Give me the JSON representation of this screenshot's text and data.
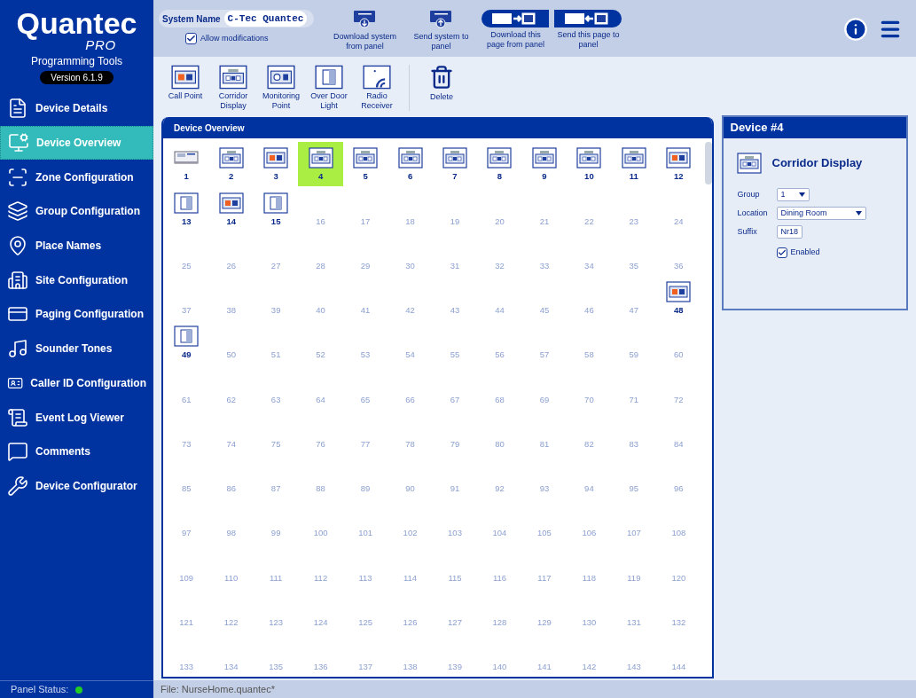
{
  "brand": {
    "name": "Quantec",
    "edition": "PRO",
    "subtitle": "Programming Tools",
    "version": "Version 6.1.9"
  },
  "sidebar": {
    "items": [
      {
        "label": "Device Details",
        "selected": false
      },
      {
        "label": "Device Overview",
        "selected": true
      },
      {
        "label": "Zone Configuration",
        "selected": false
      },
      {
        "label": "Group Configuration",
        "selected": false
      },
      {
        "label": "Place Names",
        "selected": false
      },
      {
        "label": "Site Configuration",
        "selected": false
      },
      {
        "label": "Paging Configuration",
        "selected": false
      },
      {
        "label": "Sounder Tones",
        "selected": false
      },
      {
        "label": "Caller ID Configuration",
        "selected": false
      },
      {
        "label": "Event Log Viewer",
        "selected": false
      },
      {
        "label": "Comments",
        "selected": false
      },
      {
        "label": "Device Configurator",
        "selected": false
      }
    ],
    "panel_status": {
      "label": "Panel Status:",
      "color": "#22cc22"
    }
  },
  "topbar": {
    "system_name": {
      "label": "System Name",
      "value": "C-Tec Quantec"
    },
    "allow_modifications": {
      "label": "Allow modifications",
      "checked": true
    },
    "actions": [
      {
        "label": "Download system from panel",
        "kind": "download"
      },
      {
        "label": "Send system to panel",
        "kind": "send"
      },
      {
        "label": "Download this page from panel",
        "kind": "page-download"
      },
      {
        "label": "Send this page to panel",
        "kind": "page-send"
      }
    ]
  },
  "toolbar": {
    "devices": [
      {
        "label": "Call Point",
        "kind": "callpoint"
      },
      {
        "label": "Corridor Display",
        "kind": "corridor"
      },
      {
        "label": "Monitoring Point",
        "kind": "monitor"
      },
      {
        "label": "Over Door Light",
        "kind": "overdoor"
      },
      {
        "label": "Radio Receiver",
        "kind": "radio"
      }
    ],
    "delete": "Delete"
  },
  "overview": {
    "title": "Device Overview",
    "slots": [
      {
        "number": "1",
        "kind": "panel",
        "selected": false
      },
      {
        "number": "2",
        "kind": "corridor",
        "selected": false
      },
      {
        "number": "3",
        "kind": "callpoint",
        "selected": false
      },
      {
        "number": "4",
        "kind": "corridor",
        "selected": true
      },
      {
        "number": "5",
        "kind": "corridor",
        "selected": false
      },
      {
        "number": "6",
        "kind": "corridor",
        "selected": false
      },
      {
        "number": "7",
        "kind": "corridor",
        "selected": false
      },
      {
        "number": "8",
        "kind": "corridor",
        "selected": false
      },
      {
        "number": "9",
        "kind": "corridor",
        "selected": false
      },
      {
        "number": "10",
        "kind": "corridor",
        "selected": false
      },
      {
        "number": "11",
        "kind": "corridor",
        "selected": false
      },
      {
        "number": "12",
        "kind": "callpoint",
        "selected": false
      },
      {
        "number": "13",
        "kind": "overdoor",
        "selected": false
      },
      {
        "number": "14",
        "kind": "callpoint",
        "selected": false
      },
      {
        "number": "15",
        "kind": "overdoor",
        "selected": false
      },
      {
        "number": "16",
        "kind": "empty",
        "selected": false
      },
      {
        "number": "17",
        "kind": "empty",
        "selected": false
      },
      {
        "number": "18",
        "kind": "empty",
        "selected": false
      },
      {
        "number": "19",
        "kind": "empty",
        "selected": false
      },
      {
        "number": "20",
        "kind": "empty",
        "selected": false
      },
      {
        "number": "21",
        "kind": "empty",
        "selected": false
      },
      {
        "number": "22",
        "kind": "empty",
        "selected": false
      },
      {
        "number": "23",
        "kind": "empty",
        "selected": false
      },
      {
        "number": "24",
        "kind": "empty",
        "selected": false
      },
      {
        "number": "25",
        "kind": "empty",
        "selected": false
      },
      {
        "number": "26",
        "kind": "empty",
        "selected": false
      },
      {
        "number": "27",
        "kind": "empty",
        "selected": false
      },
      {
        "number": "28",
        "kind": "empty",
        "selected": false
      },
      {
        "number": "29",
        "kind": "empty",
        "selected": false
      },
      {
        "number": "30",
        "kind": "empty",
        "selected": false
      },
      {
        "number": "31",
        "kind": "empty",
        "selected": false
      },
      {
        "number": "32",
        "kind": "empty",
        "selected": false
      },
      {
        "number": "33",
        "kind": "empty",
        "selected": false
      },
      {
        "number": "34",
        "kind": "empty",
        "selected": false
      },
      {
        "number": "35",
        "kind": "empty",
        "selected": false
      },
      {
        "number": "36",
        "kind": "empty",
        "selected": false
      },
      {
        "number": "37",
        "kind": "empty",
        "selected": false
      },
      {
        "number": "38",
        "kind": "empty",
        "selected": false
      },
      {
        "number": "39",
        "kind": "empty",
        "selected": false
      },
      {
        "number": "40",
        "kind": "empty",
        "selected": false
      },
      {
        "number": "41",
        "kind": "empty",
        "selected": false
      },
      {
        "number": "42",
        "kind": "empty",
        "selected": false
      },
      {
        "number": "43",
        "kind": "empty",
        "selected": false
      },
      {
        "number": "44",
        "kind": "empty",
        "selected": false
      },
      {
        "number": "45",
        "kind": "empty",
        "selected": false
      },
      {
        "number": "46",
        "kind": "empty",
        "selected": false
      },
      {
        "number": "47",
        "kind": "empty",
        "selected": false
      },
      {
        "number": "48",
        "kind": "callpoint",
        "selected": false
      },
      {
        "number": "49",
        "kind": "overdoor",
        "selected": false
      },
      {
        "number": "50",
        "kind": "empty",
        "selected": false
      },
      {
        "number": "51",
        "kind": "empty",
        "selected": false
      },
      {
        "number": "52",
        "kind": "empty",
        "selected": false
      },
      {
        "number": "53",
        "kind": "empty",
        "selected": false
      },
      {
        "number": "54",
        "kind": "empty",
        "selected": false
      },
      {
        "number": "55",
        "kind": "empty",
        "selected": false
      },
      {
        "number": "56",
        "kind": "empty",
        "selected": false
      },
      {
        "number": "57",
        "kind": "empty",
        "selected": false
      },
      {
        "number": "58",
        "kind": "empty",
        "selected": false
      },
      {
        "number": "59",
        "kind": "empty",
        "selected": false
      },
      {
        "number": "60",
        "kind": "empty",
        "selected": false
      },
      {
        "number": "61",
        "kind": "empty",
        "selected": false
      },
      {
        "number": "62",
        "kind": "empty",
        "selected": false
      },
      {
        "number": "63",
        "kind": "empty",
        "selected": false
      },
      {
        "number": "64",
        "kind": "empty",
        "selected": false
      },
      {
        "number": "65",
        "kind": "empty",
        "selected": false
      },
      {
        "number": "66",
        "kind": "empty",
        "selected": false
      },
      {
        "number": "67",
        "kind": "empty",
        "selected": false
      },
      {
        "number": "68",
        "kind": "empty",
        "selected": false
      },
      {
        "number": "69",
        "kind": "empty",
        "selected": false
      },
      {
        "number": "70",
        "kind": "empty",
        "selected": false
      },
      {
        "number": "71",
        "kind": "empty",
        "selected": false
      },
      {
        "number": "72",
        "kind": "empty",
        "selected": false
      },
      {
        "number": "73",
        "kind": "empty",
        "selected": false
      },
      {
        "number": "74",
        "kind": "empty",
        "selected": false
      },
      {
        "number": "75",
        "kind": "empty",
        "selected": false
      },
      {
        "number": "76",
        "kind": "empty",
        "selected": false
      },
      {
        "number": "77",
        "kind": "empty",
        "selected": false
      },
      {
        "number": "78",
        "kind": "empty",
        "selected": false
      },
      {
        "number": "79",
        "kind": "empty",
        "selected": false
      },
      {
        "number": "80",
        "kind": "empty",
        "selected": false
      },
      {
        "number": "81",
        "kind": "empty",
        "selected": false
      },
      {
        "number": "82",
        "kind": "empty",
        "selected": false
      },
      {
        "number": "83",
        "kind": "empty",
        "selected": false
      },
      {
        "number": "84",
        "kind": "empty",
        "selected": false
      },
      {
        "number": "85",
        "kind": "empty",
        "selected": false
      },
      {
        "number": "86",
        "kind": "empty",
        "selected": false
      },
      {
        "number": "87",
        "kind": "empty",
        "selected": false
      },
      {
        "number": "88",
        "kind": "empty",
        "selected": false
      },
      {
        "number": "89",
        "kind": "empty",
        "selected": false
      },
      {
        "number": "90",
        "kind": "empty",
        "selected": false
      },
      {
        "number": "91",
        "kind": "empty",
        "selected": false
      },
      {
        "number": "92",
        "kind": "empty",
        "selected": false
      },
      {
        "number": "93",
        "kind": "empty",
        "selected": false
      },
      {
        "number": "94",
        "kind": "empty",
        "selected": false
      },
      {
        "number": "95",
        "kind": "empty",
        "selected": false
      },
      {
        "number": "96",
        "kind": "empty",
        "selected": false
      },
      {
        "number": "97",
        "kind": "empty",
        "selected": false
      },
      {
        "number": "98",
        "kind": "empty",
        "selected": false
      },
      {
        "number": "99",
        "kind": "empty",
        "selected": false
      },
      {
        "number": "100",
        "kind": "empty",
        "selected": false
      },
      {
        "number": "101",
        "kind": "empty",
        "selected": false
      },
      {
        "number": "102",
        "kind": "empty",
        "selected": false
      },
      {
        "number": "103",
        "kind": "empty",
        "selected": false
      },
      {
        "number": "104",
        "kind": "empty",
        "selected": false
      },
      {
        "number": "105",
        "kind": "empty",
        "selected": false
      },
      {
        "number": "106",
        "kind": "empty",
        "selected": false
      },
      {
        "number": "107",
        "kind": "empty",
        "selected": false
      },
      {
        "number": "108",
        "kind": "empty",
        "selected": false
      },
      {
        "number": "109",
        "kind": "empty",
        "selected": false
      },
      {
        "number": "110",
        "kind": "empty",
        "selected": false
      },
      {
        "number": "111",
        "kind": "empty",
        "selected": false
      },
      {
        "number": "112",
        "kind": "empty",
        "selected": false
      },
      {
        "number": "113",
        "kind": "empty",
        "selected": false
      },
      {
        "number": "114",
        "kind": "empty",
        "selected": false
      },
      {
        "number": "115",
        "kind": "empty",
        "selected": false
      },
      {
        "number": "116",
        "kind": "empty",
        "selected": false
      },
      {
        "number": "117",
        "kind": "empty",
        "selected": false
      },
      {
        "number": "118",
        "kind": "empty",
        "selected": false
      },
      {
        "number": "119",
        "kind": "empty",
        "selected": false
      },
      {
        "number": "120",
        "kind": "empty",
        "selected": false
      },
      {
        "number": "121",
        "kind": "empty",
        "selected": false
      },
      {
        "number": "122",
        "kind": "empty",
        "selected": false
      },
      {
        "number": "123",
        "kind": "empty",
        "selected": false
      },
      {
        "number": "124",
        "kind": "empty",
        "selected": false
      },
      {
        "number": "125",
        "kind": "empty",
        "selected": false
      },
      {
        "number": "126",
        "kind": "empty",
        "selected": false
      },
      {
        "number": "127",
        "kind": "empty",
        "selected": false
      },
      {
        "number": "128",
        "kind": "empty",
        "selected": false
      },
      {
        "number": "129",
        "kind": "empty",
        "selected": false
      },
      {
        "number": "130",
        "kind": "empty",
        "selected": false
      },
      {
        "number": "131",
        "kind": "empty",
        "selected": false
      },
      {
        "number": "132",
        "kind": "empty",
        "selected": false
      },
      {
        "number": "133",
        "kind": "empty",
        "selected": false
      },
      {
        "number": "134",
        "kind": "empty",
        "selected": false
      },
      {
        "number": "135",
        "kind": "empty",
        "selected": false
      },
      {
        "number": "136",
        "kind": "empty",
        "selected": false
      },
      {
        "number": "137",
        "kind": "empty",
        "selected": false
      },
      {
        "number": "138",
        "kind": "empty",
        "selected": false
      },
      {
        "number": "139",
        "kind": "empty",
        "selected": false
      },
      {
        "number": "140",
        "kind": "empty",
        "selected": false
      },
      {
        "number": "141",
        "kind": "empty",
        "selected": false
      },
      {
        "number": "142",
        "kind": "empty",
        "selected": false
      },
      {
        "number": "143",
        "kind": "empty",
        "selected": false
      },
      {
        "number": "144",
        "kind": "empty",
        "selected": false
      }
    ]
  },
  "device_panel": {
    "title": "Device #4",
    "kind": "corridor",
    "name": "Corridor Display",
    "fields": [
      {
        "label": "Group",
        "value": "1",
        "kind": "select-small"
      },
      {
        "label": "Location",
        "value": "Dining Room",
        "kind": "select"
      },
      {
        "label": "Suffix",
        "value": "Nr18",
        "kind": "text"
      }
    ],
    "enabled": {
      "label": "Enabled",
      "checked": true
    }
  },
  "status_bar": {
    "file": "File: NurseHome.quantec*"
  }
}
